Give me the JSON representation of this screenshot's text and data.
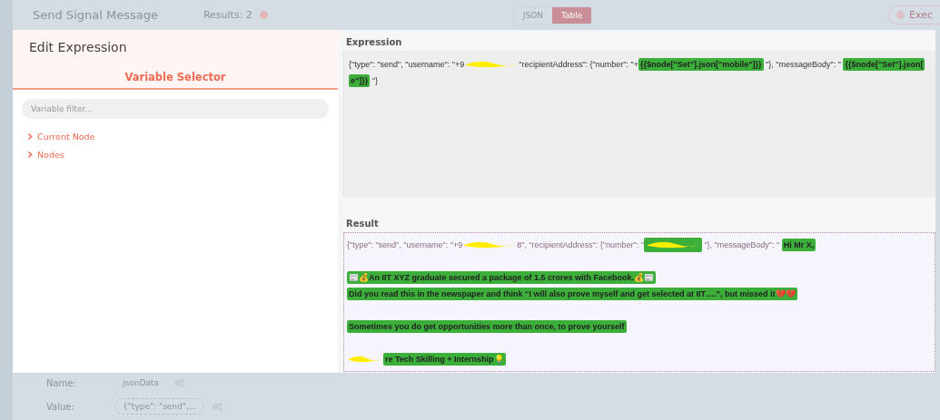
{
  "background": {
    "title": "Send Signal Message",
    "results": "Results: 2",
    "view_tabs": [
      {
        "label": "JSON",
        "selected": false
      },
      {
        "label": "Table",
        "selected": true
      }
    ],
    "execute_button": "Exec",
    "parameters": [
      {
        "label": "Name:",
        "value": "jsonData",
        "kind": "text"
      },
      {
        "label": "Value:",
        "value": "{\"type\": \"send\",...",
        "kind": "expression"
      }
    ]
  },
  "dialog": {
    "title": "Edit Expression",
    "tab": "Variable Selector",
    "filter": {
      "placeholder": "Variable filter..."
    },
    "tree": [
      {
        "label": "Current Node",
        "expanded": false
      },
      {
        "label": "Nodes",
        "expanded": false
      }
    ],
    "expression": {
      "label": "Expression",
      "lines": [
        {
          "segments": [
            {
              "kind": "text",
              "text": "{\"type\": \"send\", \"username\": \"+9"
            },
            {
              "kind": "mask"
            },
            {
              "kind": "text",
              "text": "\"recipientAddress\": {\"number\": \"+"
            },
            {
              "kind": "expr",
              "text": "{{$node[\"Set\"].json[\"mobile\"]}}"
            },
            {
              "kind": "text",
              "text": " \"}, \"messageBody\": \" "
            },
            {
              "kind": "expr",
              "text": "{{$node[\"Set\"].json["
            }
          ]
        },
        {
          "segments": [
            {
              "kind": "expr",
              "text": "e\"]}}"
            },
            {
              "kind": "text",
              "text": " \"}"
            }
          ]
        }
      ]
    },
    "result": {
      "label": "Result",
      "lines": [
        {
          "kind": "line",
          "segments": [
            {
              "kind": "text",
              "text": "{\"type\": \"send\", \"username\": \"+9"
            },
            {
              "kind": "mask"
            },
            {
              "kind": "text",
              "text": "8\", \"recipientAddress\": {\"number\": \""
            },
            {
              "kind": "masked-expr"
            },
            {
              "kind": "text",
              "text": " \"}, \"messageBody\": \" "
            },
            {
              "kind": "expr",
              "text": "Hi Mr X,"
            }
          ]
        },
        {
          "kind": "paragraph",
          "segments": [
            {
              "kind": "expr",
              "text": "📰💰An IIT XYZ graduate secured a package of 1.5 crores with Facebook.💰📰"
            }
          ]
        },
        {
          "kind": "line",
          "segments": [
            {
              "kind": "expr",
              "text": "Did you read this in the newspaper and think “I will also prove myself and get selected at IIT….”, but missed it💔💔"
            }
          ]
        },
        {
          "kind": "paragraph",
          "segments": [
            {
              "kind": "expr",
              "text": "Sometimes you do get opportunities more than once, to prove yourself"
            }
          ]
        },
        {
          "kind": "paragraph",
          "segments": [
            {
              "kind": "masked-expr",
              "text": "re Tech Skilling + Internship💡"
            }
          ]
        }
      ]
    }
  }
}
